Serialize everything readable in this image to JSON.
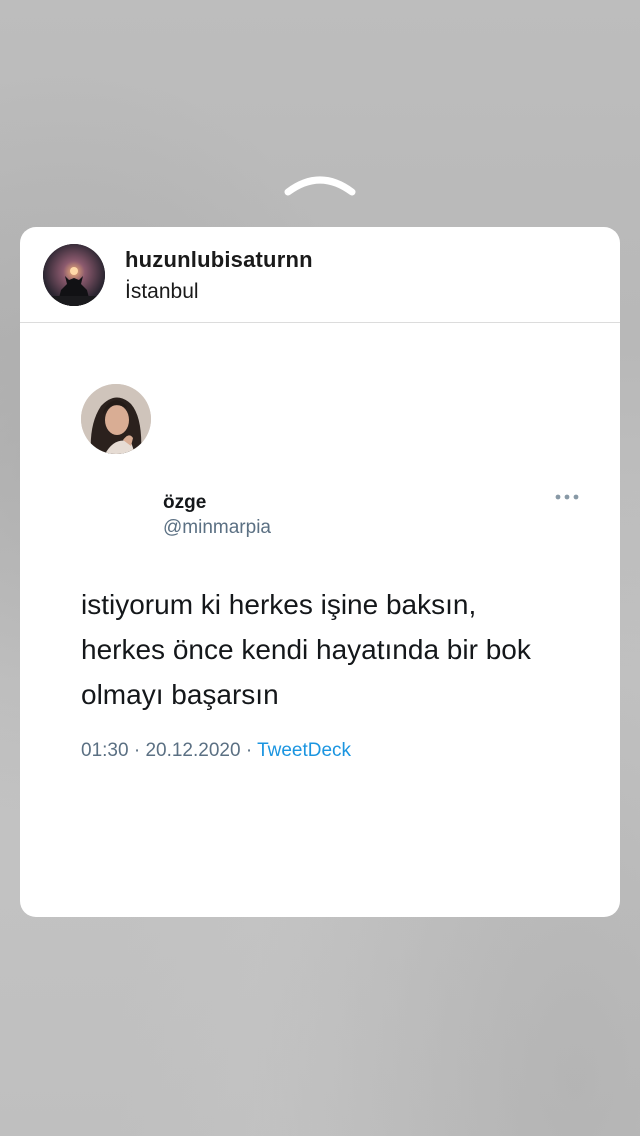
{
  "header": {
    "username": "huzunlubisaturnn",
    "location": "İstanbul"
  },
  "tweet": {
    "name": "özge",
    "handle": "@minmarpia",
    "text_lines": [
      "istiyorum ki herkes işine baksın,",
      "herkes önce kendi hayatında bir bok",
      "olmayı başarsın"
    ],
    "time": "01:30",
    "separator": "·",
    "date": "20.12.2020",
    "source": "TweetDeck"
  },
  "icons": {
    "swipe_up": "chevron-up-icon",
    "more": "more-horizontal-icon"
  },
  "colors": {
    "link": "#1b95e0",
    "secondary_text": "#5b7083",
    "card_background": "#ffffff"
  }
}
